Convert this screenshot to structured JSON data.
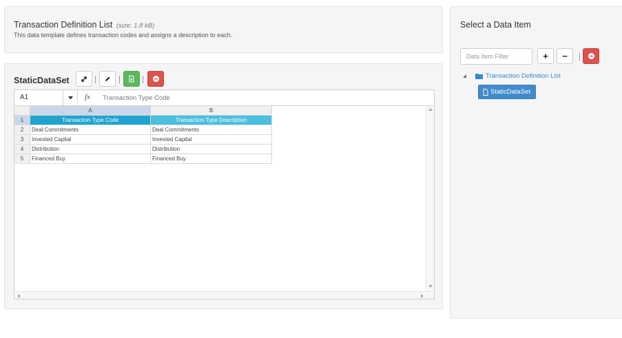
{
  "header": {
    "title": "Transaction Definition List",
    "size": "(size: 1.8 kB)",
    "description": "This data template defines transaction codes and assigns a description to each."
  },
  "dataset": {
    "title": "StaticDataSet",
    "toolbar": [
      "expand-icon",
      "edit-icon",
      "export-icon",
      "remove-icon"
    ]
  },
  "spreadsheet": {
    "name_box": "A1",
    "fx_label": "fx",
    "formula_value": "Transaction Type Code",
    "columns": [
      "A",
      "B"
    ],
    "rows": [
      {
        "num": "1",
        "cells": [
          "Transaction Type Code",
          "Transaction Type Description"
        ]
      },
      {
        "num": "2",
        "cells": [
          "Deal Commitments",
          "Deal Commitments"
        ]
      },
      {
        "num": "3",
        "cells": [
          "Invested Capital",
          "Invested Capital"
        ]
      },
      {
        "num": "4",
        "cells": [
          "Distribution",
          "Distribution"
        ]
      },
      {
        "num": "5",
        "cells": [
          "Financed Buy",
          "Financed Buy"
        ]
      }
    ]
  },
  "side": {
    "title": "Select a Data Item",
    "filter_placeholder": "Data Item Filter",
    "add_label": "+",
    "minus_label": "−",
    "tree": {
      "root": "Transaction Definition List",
      "child": "StaticDataSet"
    }
  },
  "colors": {
    "header_active": "#1fa4cf",
    "header_cell": "#4bbfe0",
    "success": "#5cb85c",
    "danger": "#d9534f",
    "primary": "#428bca"
  }
}
